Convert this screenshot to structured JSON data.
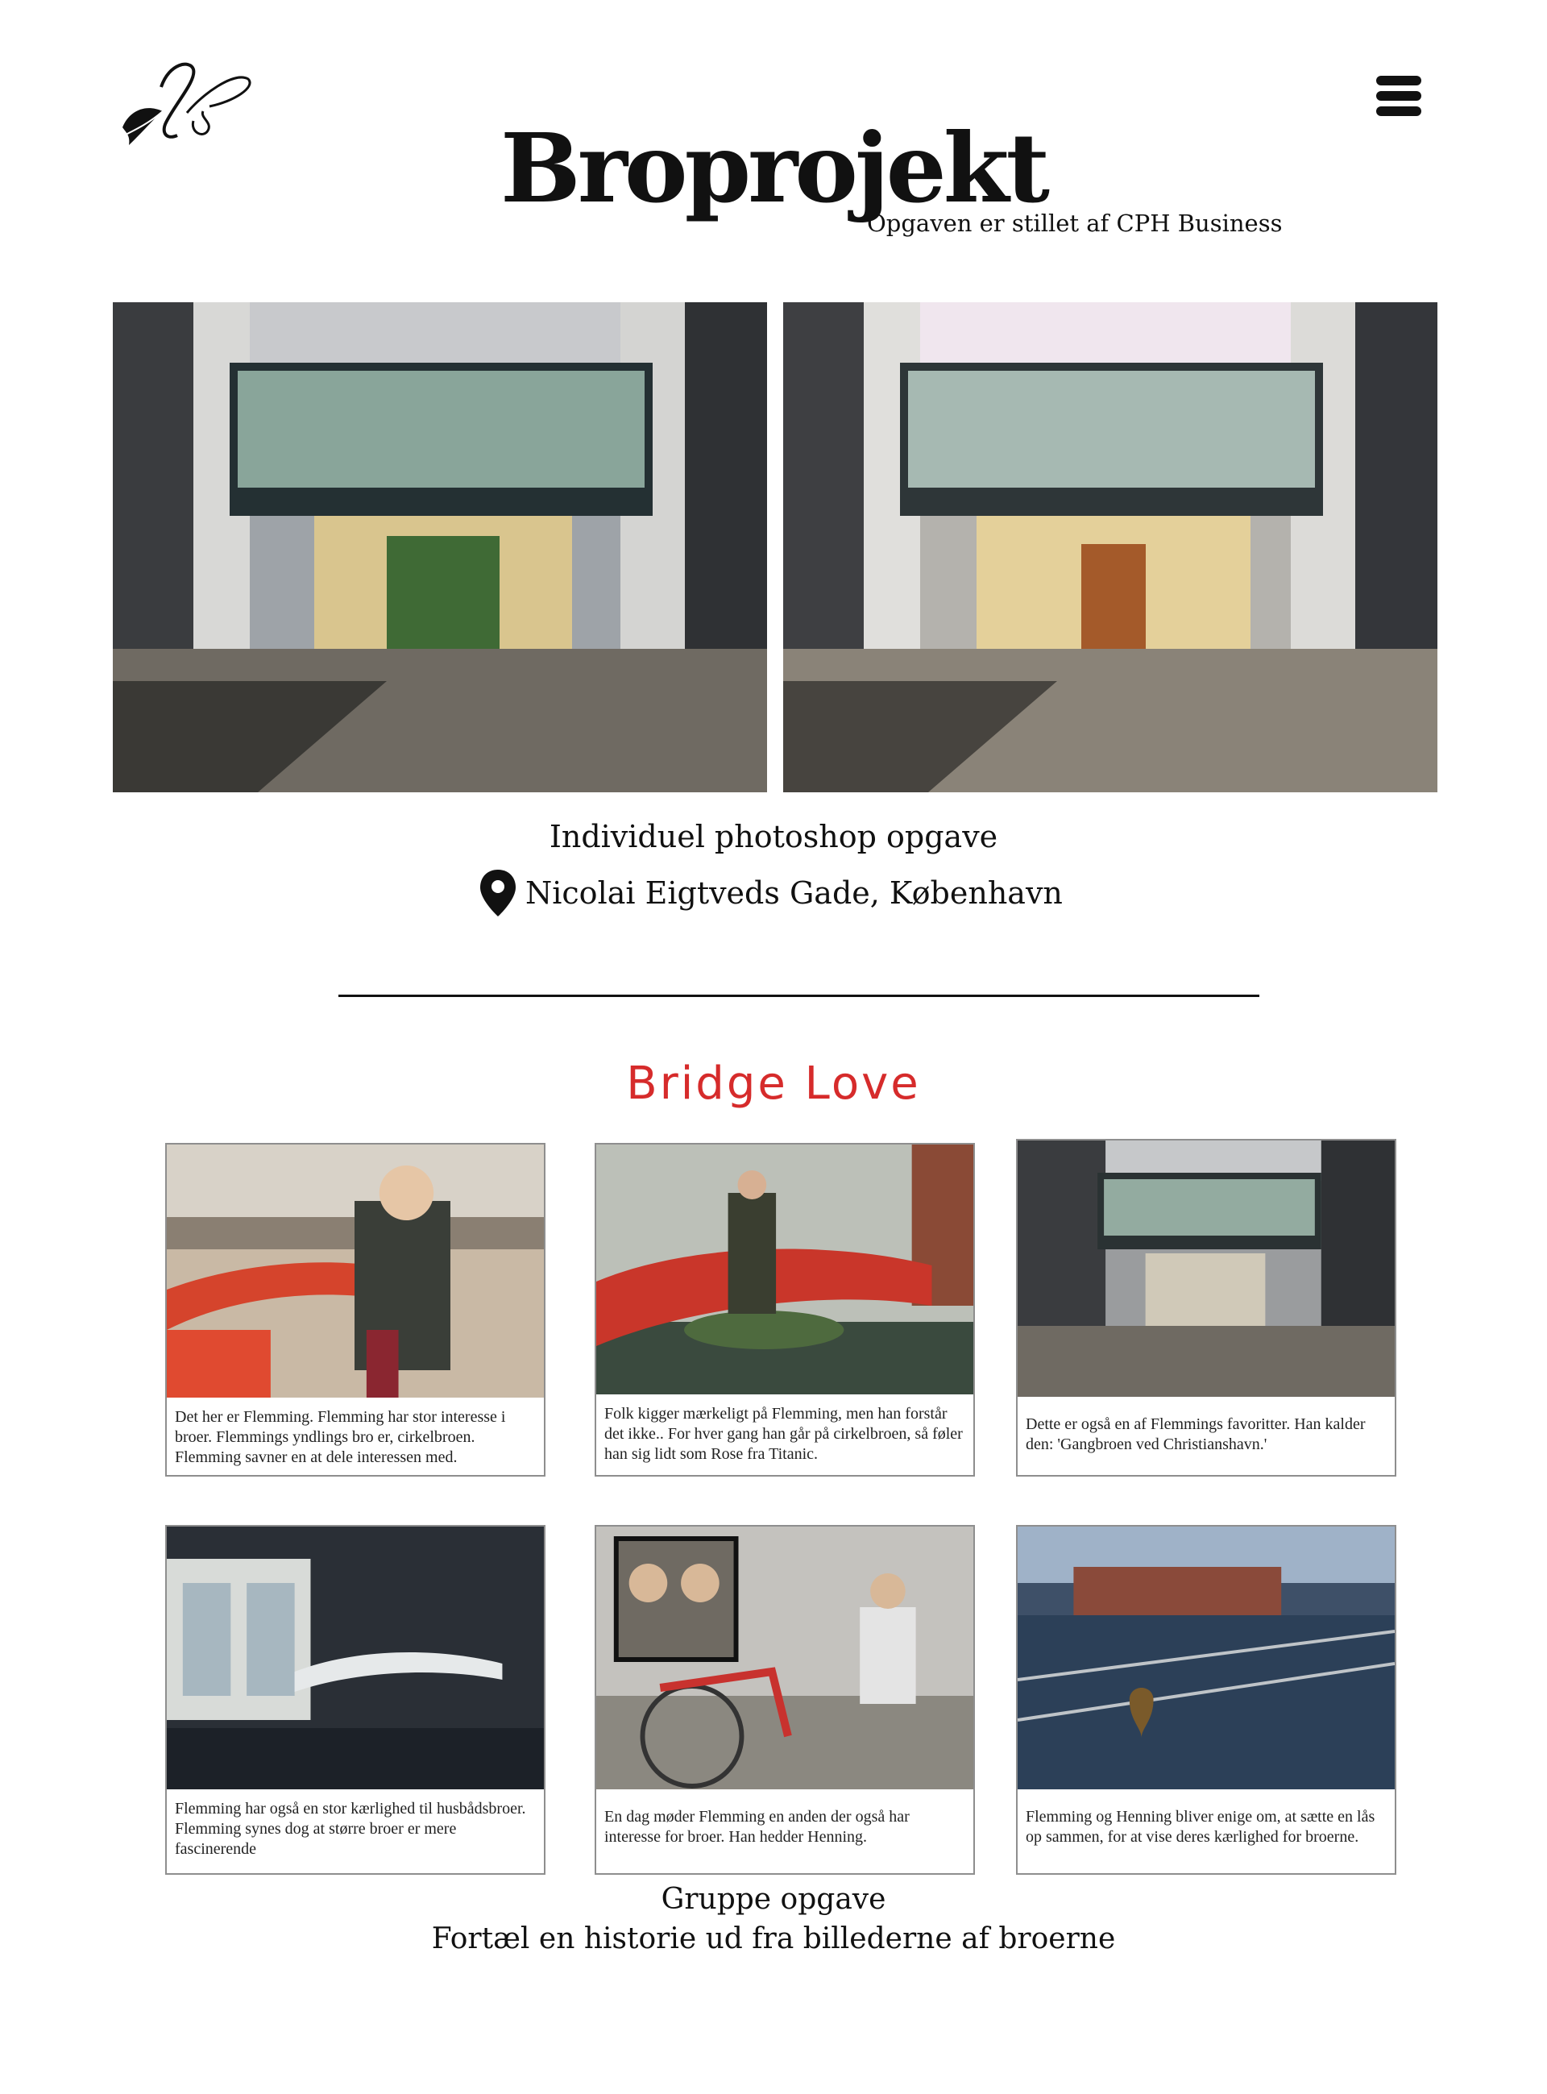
{
  "header": {
    "logo_icon": "feather-monogram-logo",
    "menu_icon": "hamburger-menu-icon",
    "title": "Broprojekt",
    "subtitle": "Opgaven er stillet af CPH Business"
  },
  "individual": {
    "caption": "Individuel photoshop opgave",
    "location_icon": "map-pin-icon",
    "location": "Nicolai Eigtveds Gade, København"
  },
  "group_section": {
    "heading": "Bridge Love",
    "heading_color": "#d62b2b",
    "cards": [
      {
        "text": "Det her er Flemming. Flemming har stor interesse i broer. Flemmings yndlings bro er, cirkelbroen. Flemming savner en at dele interessen med."
      },
      {
        "text": "Folk kigger mærkeligt på Flemming, men han forstår det ikke.. For hver gang han går på cirkelbroen, så føler han sig lidt som Rose fra Titanic."
      },
      {
        "text": "Dette er også en af Flemmings favoritter. Han kalder den: 'Gangbroen ved Christianshavn.'"
      },
      {
        "text": "Flemming har også en stor kærlighed til husbådsbroer. Flemming synes dog at større broer er mere fascinerende"
      },
      {
        "text": "En dag møder Flemming en anden der også har interesse for broer. Han hedder Henning."
      },
      {
        "text": "Flemming og Henning bliver enige om, at sætte en lås op sammen, for at vise deres kærlighed for broerne."
      }
    ],
    "caption_line1": "Gruppe opgave",
    "caption_line2": "Fortæl en historie ud fra billederne af broerne"
  }
}
